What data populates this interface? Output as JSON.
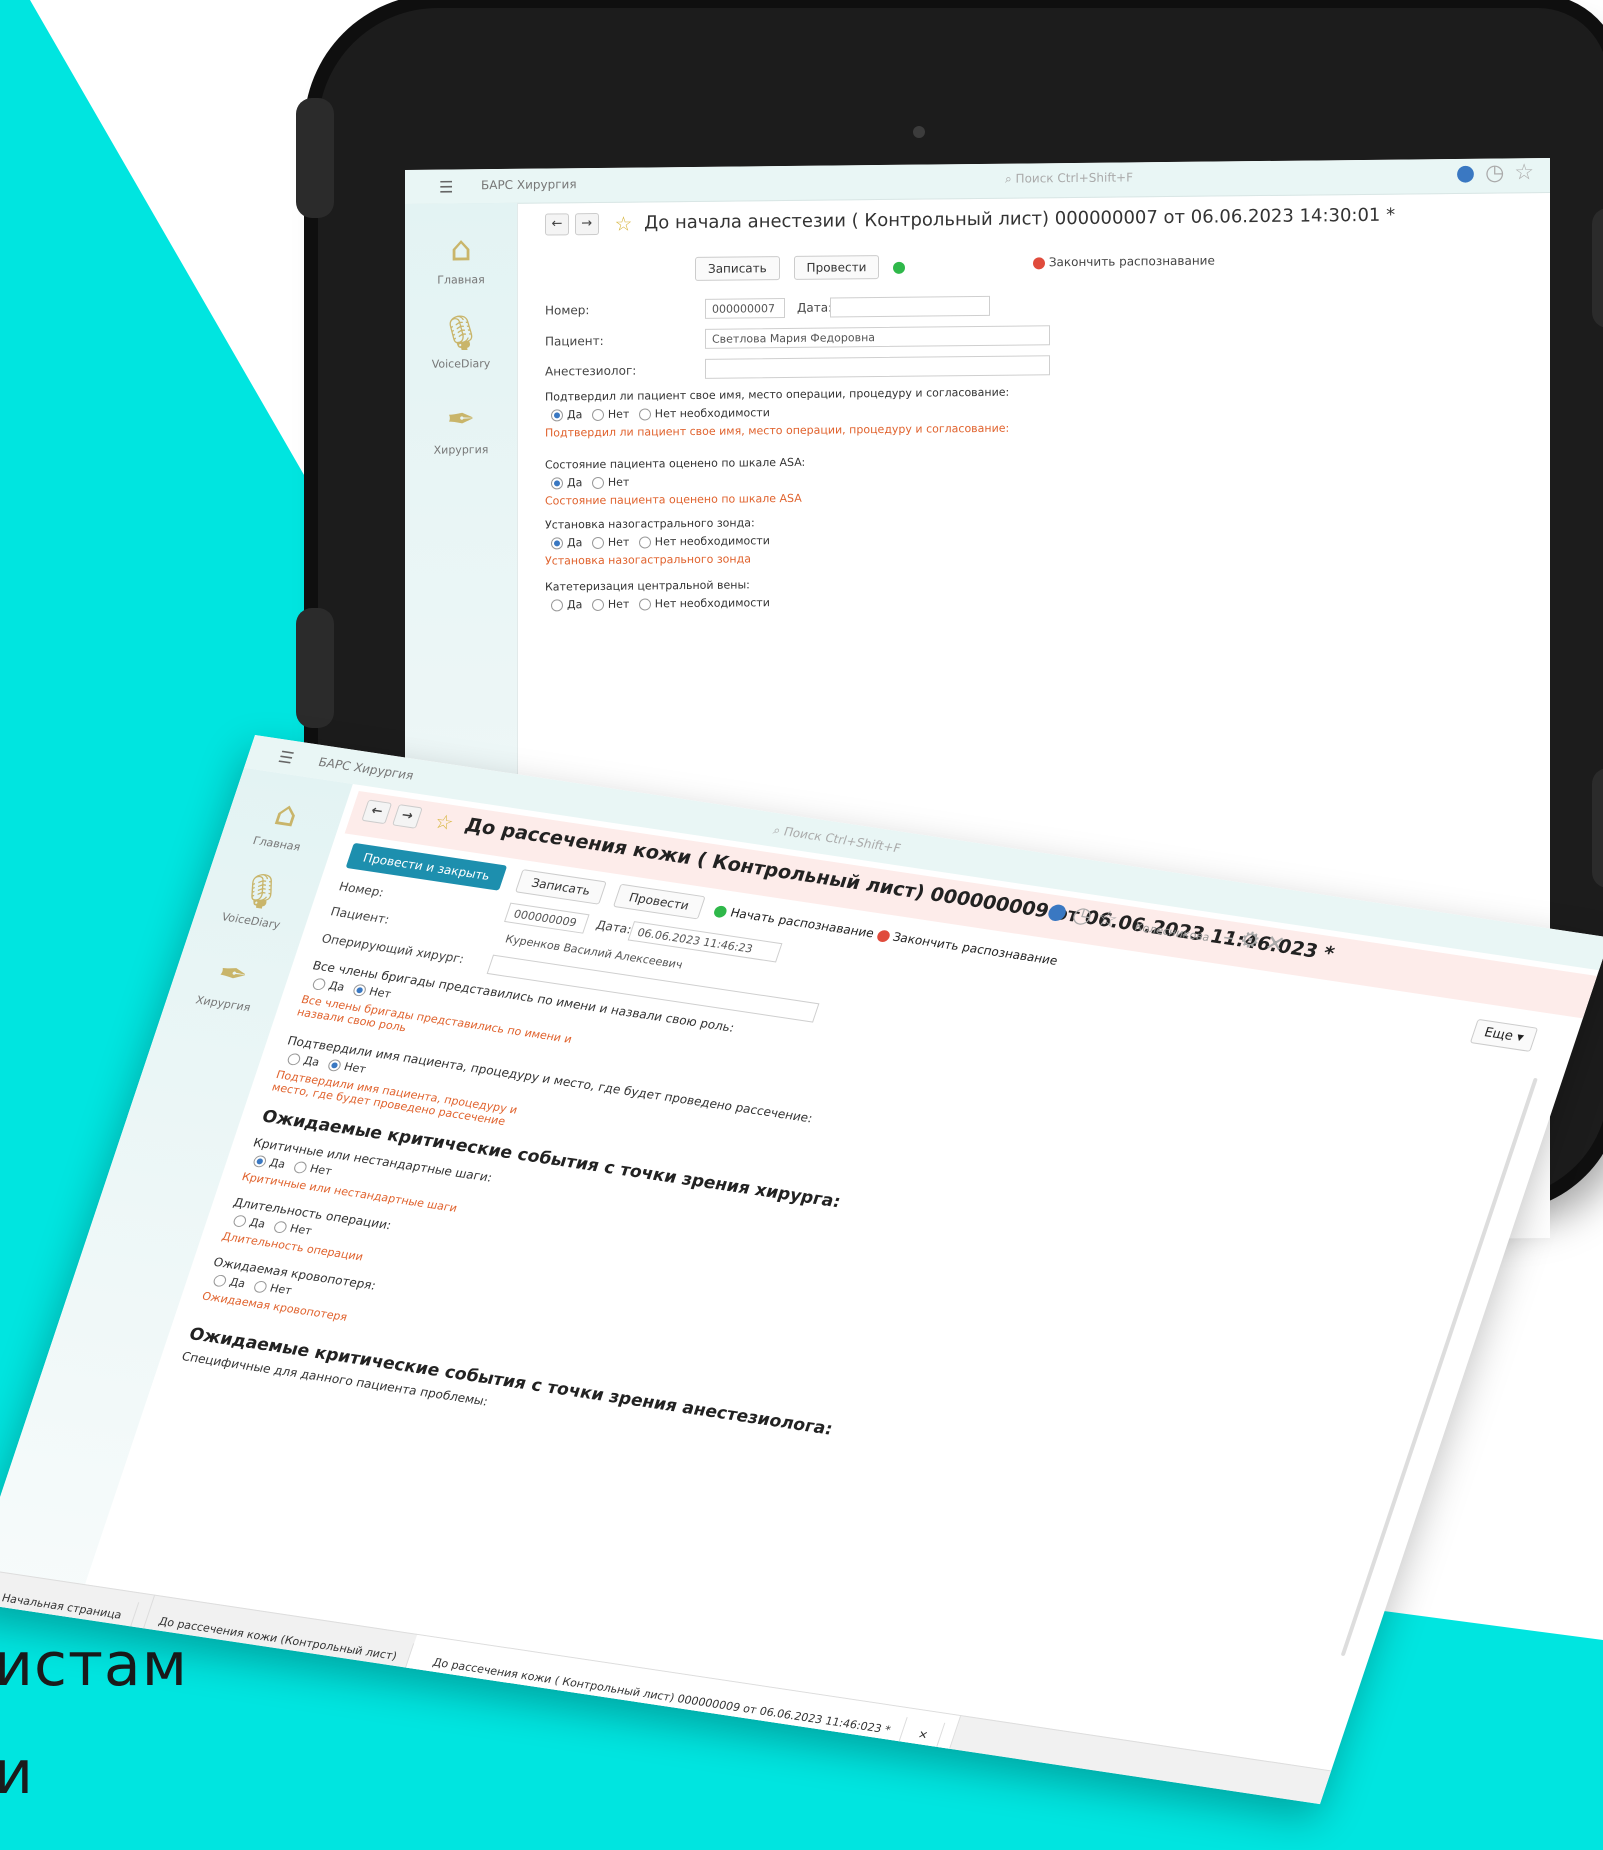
{
  "caption": {
    "line1": "истам",
    "line2": "и"
  },
  "colors": {
    "background": "#00e5e0",
    "accent": "#1d8fae",
    "warning": "#e0622d"
  },
  "back_window": {
    "app_title": "БАРС Хирургия",
    "search_placeholder": "Поиск Ctrl+Shift+F",
    "sidebar": [
      {
        "icon": "home-icon",
        "label": "Главная"
      },
      {
        "icon": "microphone-icon",
        "label": "VoiceDiary"
      },
      {
        "icon": "pen-icon",
        "label": "Хирургия"
      }
    ],
    "doc_title": "До начала анестезии ( Контрольный лист) 000000007 от 06.06.2023 14:30:01 *",
    "buttons": {
      "save": "Записать",
      "post": "Провести",
      "stop_recognition": "Закончить распознавание"
    },
    "fields": {
      "number_label": "Номер:",
      "number_value": "000000007",
      "date_label": "Дата:",
      "patient_label": "Пациент:",
      "patient_value": "Светлова Мария Федоровна",
      "anesthesiologist_label": "Анестезиолог:"
    },
    "questions": [
      {
        "q": "Подтвердил ли пациент свое имя, место операции, процедуру и согласование:",
        "opts": [
          "Да",
          "Нет",
          "Нет необходимости"
        ],
        "selected": 0,
        "warn": "Подтвердил ли пациент свое имя, место операции, процедуру и согласование:"
      },
      {
        "q": "Состояние пациента оценено по шкале ASA:",
        "opts": [
          "Да",
          "Нет"
        ],
        "selected": 0,
        "warn": "Состояние пациента оценено по шкале ASA"
      },
      {
        "q": "Установка назогастрального зонда:",
        "opts": [
          "Да",
          "Нет",
          "Нет необходимости"
        ],
        "selected": 0,
        "warn": "Установка назогастрального зонда"
      },
      {
        "q": "Катетеризация центральной вены:",
        "opts": [
          "Да",
          "Нет",
          "Нет необходимости"
        ],
        "selected": -1,
        "warn": ""
      }
    ]
  },
  "front_window": {
    "app_title": "БАРС Хирургия",
    "search_placeholder": "Поиск Ctrl+Shift+F",
    "doc_title": "До рассечения кожи ( Контрольный лист) 000000009 от 06.06.2023 11:46:023 *",
    "user_label": "Колесникова",
    "sidebar": [
      {
        "icon": "home-icon",
        "label": "Главная"
      },
      {
        "icon": "microphone-icon",
        "label": "VoiceDiary"
      },
      {
        "icon": "pen-icon",
        "label": "Хирургия"
      }
    ],
    "buttons": {
      "post_close": "Провести и закрыть",
      "save": "Записать",
      "post": "Провести",
      "start_recognition": "Начать распознавание",
      "stop_recognition": "Закончить распознавание",
      "more": "Еще"
    },
    "fields": {
      "number_label": "Номер:",
      "number_value": "000000009",
      "date_label": "Дата:",
      "date_value": "06.06.2023 11:46:23",
      "patient_label": "Пациент:",
      "patient_value": "Куренков Василий Алексеевич",
      "surgeon_label": "Оперирующий хирург:"
    },
    "q1": {
      "q": "Все члены бригады представились по имени и назвали свою роль:",
      "opts": [
        "Да",
        "Нет"
      ],
      "warn": "Все члены бригады представились по имени и назвали свою роль"
    },
    "q2": {
      "q": "Подтвердили имя пациента, процедуру и место, где будет проведено рассечение:",
      "opts": [
        "Да",
        "Нет"
      ],
      "warn": "Подтвердили имя пациента, процедуру и место, где будет проведено рассечение"
    },
    "section1": "Ожидаемые критические события с точки зрения хирурга:",
    "sub_questions": [
      {
        "q": "Критичные или нестандартные шаги:",
        "opts": [
          "Да",
          "Нет"
        ],
        "warn": "Критичные или нестандартные шаги"
      },
      {
        "q": "Длительность операции:",
        "opts": [
          "Да",
          "Нет"
        ],
        "warn": "Длительность операции"
      },
      {
        "q": "Ожидаемая кровопотеря:",
        "opts": [
          "Да",
          "Нет"
        ],
        "warn": "Ожидаемая кровопотеря"
      }
    ],
    "section2": "Ожидаемые критические события с точки зрения анестезиолога:",
    "section2_sub": "Специфичные для данного пациента проблемы:",
    "tabs": [
      "Начальная страница",
      "До рассечения кожи (Контрольный лист)",
      "До рассечения кожи ( Контрольный лист) 000000009 от 06.06.2023 11:46:023 *"
    ]
  }
}
